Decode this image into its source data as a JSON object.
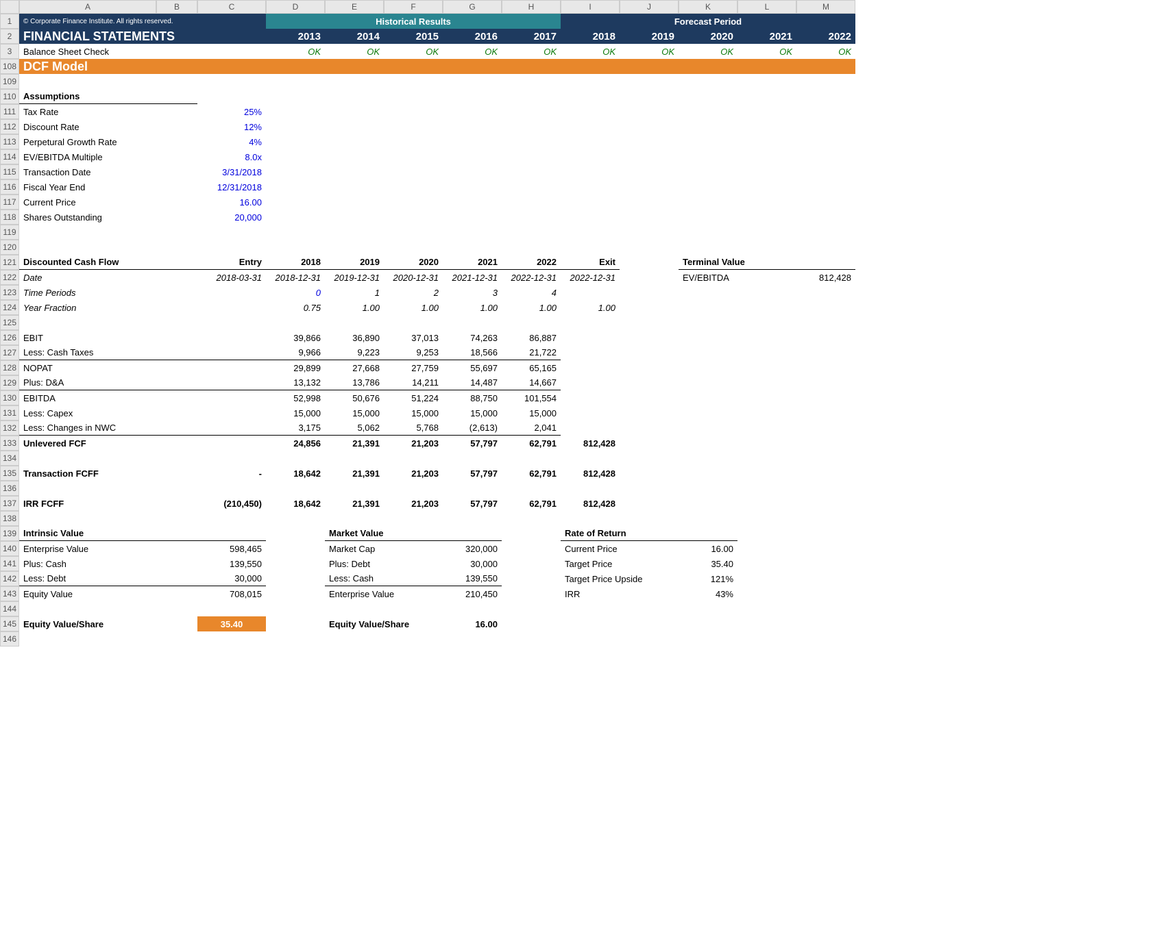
{
  "columns": [
    "A",
    "B",
    "C",
    "D",
    "E",
    "F",
    "G",
    "H",
    "I",
    "J",
    "K",
    "L",
    "M"
  ],
  "copyright": "© Corporate Finance Institute. All rights reserved.",
  "historical_label": "Historical Results",
  "forecast_label": "Forecast Period",
  "title": "FINANCIAL STATEMENTS",
  "years": [
    "2013",
    "2014",
    "2015",
    "2016",
    "2017",
    "2018",
    "2019",
    "2020",
    "2021",
    "2022"
  ],
  "bsc_label": "Balance Sheet Check",
  "ok": "OK",
  "dcf_banner": "DCF Model",
  "assumptions_label": "Assumptions",
  "assumptions": [
    {
      "label": "Tax Rate",
      "value": "25%"
    },
    {
      "label": "Discount Rate",
      "value": "12%"
    },
    {
      "label": "Perpetural Growth Rate",
      "value": "4%"
    },
    {
      "label": "EV/EBITDA Multiple",
      "value": "8.0x"
    },
    {
      "label": "Transaction Date",
      "value": "3/31/2018"
    },
    {
      "label": "Fiscal Year End",
      "value": "12/31/2018"
    },
    {
      "label": "Current Price",
      "value": "16.00"
    },
    {
      "label": "Shares Outstanding",
      "value": "20,000"
    }
  ],
  "dcf_header": {
    "label": "Discounted Cash Flow",
    "entry": "Entry",
    "years": [
      "2018",
      "2019",
      "2020",
      "2021",
      "2022"
    ],
    "exit": "Exit"
  },
  "tv_label": "Terminal Value",
  "tv_row": {
    "label": "EV/EBITDA",
    "value": "812,428"
  },
  "date_row": {
    "label": "Date",
    "entry": "2018-03-31",
    "values": [
      "2018-12-31",
      "2019-12-31",
      "2020-12-31",
      "2021-12-31",
      "2022-12-31"
    ],
    "exit": "2022-12-31"
  },
  "tp_row": {
    "label": "Time Periods",
    "values": [
      "0",
      "1",
      "2",
      "3",
      "4"
    ]
  },
  "yf_row": {
    "label": "Year Fraction",
    "values": [
      "0.75",
      "1.00",
      "1.00",
      "1.00",
      "1.00"
    ],
    "exit": "1.00"
  },
  "lines": [
    {
      "label": "EBIT",
      "values": [
        "39,866",
        "36,890",
        "37,013",
        "74,263",
        "86,887"
      ]
    },
    {
      "label": "Less: Cash Taxes",
      "values": [
        "9,966",
        "9,223",
        "9,253",
        "18,566",
        "21,722"
      ],
      "bb": true
    },
    {
      "label": "NOPAT",
      "values": [
        "29,899",
        "27,668",
        "27,759",
        "55,697",
        "65,165"
      ]
    },
    {
      "label": "Plus: D&A",
      "values": [
        "13,132",
        "13,786",
        "14,211",
        "14,487",
        "14,667"
      ],
      "bb": true
    },
    {
      "label": "EBITDA",
      "values": [
        "52,998",
        "50,676",
        "51,224",
        "88,750",
        "101,554"
      ]
    },
    {
      "label": "Less: Capex",
      "values": [
        "15,000",
        "15,000",
        "15,000",
        "15,000",
        "15,000"
      ]
    },
    {
      "label": "Less: Changes in NWC",
      "values": [
        "3,175",
        "5,062",
        "5,768",
        "(2,613)",
        "2,041"
      ],
      "bb": true
    }
  ],
  "ufcf": {
    "label": "Unlevered FCF",
    "values": [
      "24,856",
      "21,391",
      "21,203",
      "57,797",
      "62,791"
    ],
    "exit": "812,428"
  },
  "tfcff": {
    "label": "Transaction FCFF",
    "entry": "-",
    "values": [
      "18,642",
      "21,391",
      "21,203",
      "57,797",
      "62,791"
    ],
    "exit": "812,428"
  },
  "irrfcff": {
    "label": "IRR FCFF",
    "entry": "(210,450)",
    "values": [
      "18,642",
      "21,391",
      "21,203",
      "57,797",
      "62,791"
    ],
    "exit": "812,428"
  },
  "intrinsic": {
    "header": "Intrinsic Value",
    "rows": [
      {
        "label": "Enterprise Value",
        "value": "598,465"
      },
      {
        "label": "Plus: Cash",
        "value": "139,550"
      },
      {
        "label": "Less: Debt",
        "value": "30,000",
        "bb": true
      },
      {
        "label": "Equity Value",
        "value": "708,015"
      }
    ],
    "evps_label": "Equity Value/Share",
    "evps": "35.40"
  },
  "market": {
    "header": "Market Value",
    "rows": [
      {
        "label": "Market Cap",
        "value": "320,000"
      },
      {
        "label": "Plus: Debt",
        "value": "30,000"
      },
      {
        "label": "Less: Cash",
        "value": "139,550",
        "bb": true
      },
      {
        "label": "Enterprise Value",
        "value": "210,450"
      }
    ],
    "evps_label": "Equity Value/Share",
    "evps": "16.00"
  },
  "ror": {
    "header": "Rate of Return",
    "rows": [
      {
        "label": "Current Price",
        "value": "16.00"
      },
      {
        "label": "Target Price",
        "value": "35.40"
      },
      {
        "label": "Target Price Upside",
        "value": "121%"
      },
      {
        "label": "IRR",
        "value": "43%"
      }
    ]
  },
  "row_numbers": [
    "1",
    "2",
    "3",
    "108",
    "109",
    "110",
    "111",
    "112",
    "113",
    "114",
    "115",
    "116",
    "117",
    "118",
    "119",
    "120",
    "121",
    "122",
    "123",
    "124",
    "125",
    "126",
    "127",
    "128",
    "129",
    "130",
    "131",
    "132",
    "133",
    "134",
    "135",
    "136",
    "137",
    "138",
    "139",
    "140",
    "141",
    "142",
    "143",
    "144",
    "145",
    "146"
  ]
}
